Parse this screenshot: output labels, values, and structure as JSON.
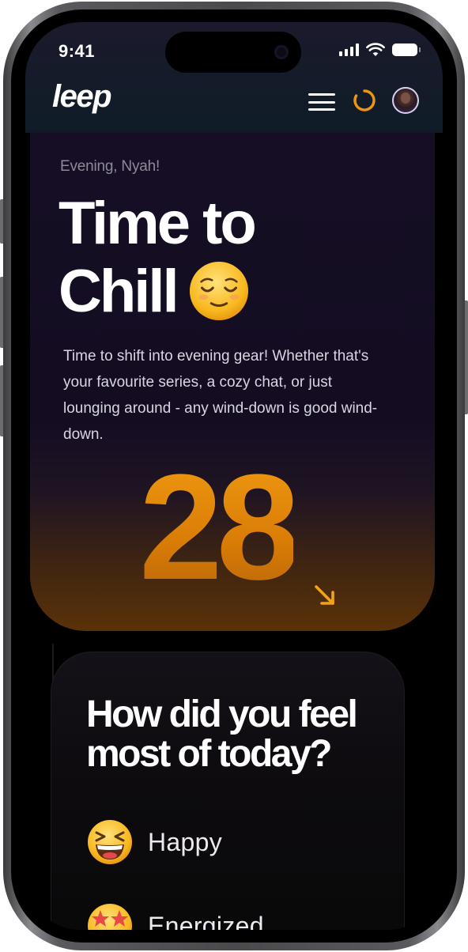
{
  "status_bar": {
    "time": "9:41"
  },
  "header": {
    "logo": "leep",
    "menu_icon": "hamburger-menu-icon",
    "progress_icon": "progress-ring-icon",
    "avatar_icon": "user-avatar"
  },
  "hero": {
    "greeting": "Evening, Nyah!",
    "title_line1": "Time to",
    "title_line2": "Chill",
    "title_emoji": "relieved-face-icon",
    "body": "Time to shift into evening gear! Whether that's your favourite series, a cozy chat, or just lounging around - any wind-down is good wind-down.",
    "score": "28",
    "trend_icon": "arrow-down-right-icon"
  },
  "question": {
    "title": "How did you feel most of today?",
    "options": [
      {
        "label": "Happy",
        "icon": "grinning-squinting-face-icon"
      },
      {
        "label": "Energized",
        "icon": "star-struck-face-icon"
      }
    ]
  },
  "colors": {
    "accent": "#f0960e",
    "card_bg": "#150e24",
    "header_bg": "#0f1c27"
  }
}
